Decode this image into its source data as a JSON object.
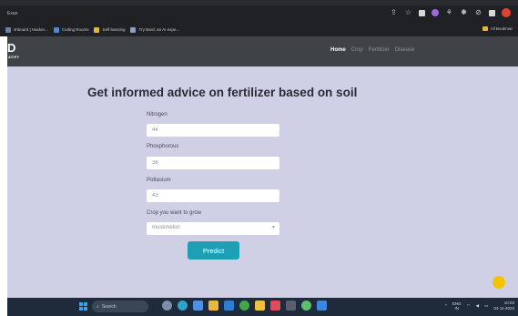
{
  "browser": {
    "tab_title": "Exan",
    "bookmarks": [
      {
        "label": "shboard | Hacker...",
        "color": "#6b7fa8"
      },
      {
        "label": "Coding Rooms",
        "color": "#4a8ad6"
      },
      {
        "label": "Self learning",
        "color": "#e0b53a"
      },
      {
        "label": "Try Bard, an AI expe...",
        "color": "#8aa0c0"
      }
    ],
    "all_bookmarks": "All Bookmar",
    "colors": {
      "chrome": "#202124",
      "profile": "#e0452c"
    }
  },
  "nav": {
    "logo_mark": "D",
    "logo_sub": "ATIFY",
    "links": [
      "Home",
      "Crop",
      "Fertilizer",
      "Disease"
    ]
  },
  "form": {
    "title": "Get informed advice on fertilizer based on soil",
    "nitrogen_label": "Nitrogen",
    "nitrogen_value": "44",
    "phosphorous_label": "Phosphorous",
    "phosphorous_value": "38",
    "pottasium_label": "Pottasium",
    "pottasium_value": "43",
    "crop_label": "Crop you want to grow",
    "crop_value": "muskmelon",
    "predict_label": "Predict",
    "colors": {
      "background": "#cfcfe6",
      "button": "#1d9fb6",
      "navbar": "#3f4247"
    }
  },
  "taskbar": {
    "search_label": "Search",
    "apps": [
      "photos-app",
      "edge-browser",
      "mail-app",
      "file-explorer",
      "vscode-app",
      "chrome-browser",
      "terminal-app",
      "copilot-app"
    ],
    "lang_top": "ENG",
    "lang_bottom": "IN",
    "time": "10:03",
    "date": "04-11-2023"
  }
}
